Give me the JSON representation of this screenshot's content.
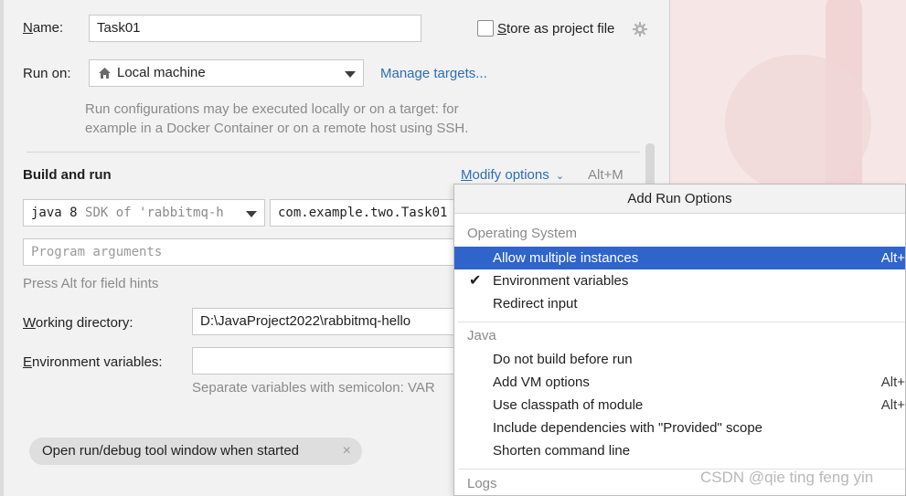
{
  "form": {
    "name_label_pre": "",
    "name_label_u": "N",
    "name_label_post": "ame:",
    "name_value": "Task01",
    "store_label_u": "S",
    "store_label_post": "tore as project file",
    "run_on_label": "Run on:",
    "run_on_value": "Local machine",
    "manage_targets": "Manage targets...",
    "run_hint_1": "Run configurations may be executed locally or on a target: for",
    "run_hint_2": "example in a Docker Container or on a remote host using SSH.",
    "build_and_run": "Build and run",
    "modify_options_u": "M",
    "modify_options_post": "odify options",
    "modify_shortcut": "Alt+M",
    "sdk_prefix": "java 8",
    "sdk_suffix": "SDK of 'rabbitmq-h",
    "main_class": "com.example.two.Task01",
    "program_args_placeholder": "Program arguments",
    "alt_hint": "Press Alt for field hints",
    "workdir_label_u": "W",
    "workdir_label_post": "orking directory:",
    "workdir_value": "D:\\JavaProject2022\\rabbitmq-hello",
    "env_label_u": "E",
    "env_label_post": "nvironment variables:",
    "env_value": "",
    "env_hint": "Separate variables with semicolon: VAR",
    "chip_label": "Open run/debug tool window when started"
  },
  "popup": {
    "title": "Add Run Options",
    "groups": [
      {
        "name": "Operating System",
        "items": [
          {
            "label": "Allow multiple instances",
            "shortcut": "Alt+",
            "selected": true,
            "checked": false
          },
          {
            "label": "Environment variables",
            "shortcut": "",
            "selected": false,
            "checked": true
          },
          {
            "label": "Redirect input",
            "shortcut": "",
            "selected": false,
            "checked": false
          }
        ]
      },
      {
        "name": "Java",
        "items": [
          {
            "label": "Do not build before run",
            "shortcut": "",
            "selected": false,
            "checked": false
          },
          {
            "label": "Add VM options",
            "shortcut": "Alt+",
            "selected": false,
            "checked": false
          },
          {
            "label": "Use classpath of module",
            "shortcut": "Alt+",
            "selected": false,
            "checked": false
          },
          {
            "label": "Include dependencies with \"Provided\" scope",
            "shortcut": "",
            "selected": false,
            "checked": false
          },
          {
            "label": "Shorten command line",
            "shortcut": "",
            "selected": false,
            "checked": false
          }
        ]
      },
      {
        "name": "Logs",
        "items": []
      }
    ]
  },
  "watermark": "CSDN @qie ting feng yin",
  "icons": {
    "gear": "gear-icon",
    "home": "home-icon",
    "check": "checkmark-icon"
  },
  "colors": {
    "accent": "#2f65ca",
    "link": "#2a6fb8"
  }
}
